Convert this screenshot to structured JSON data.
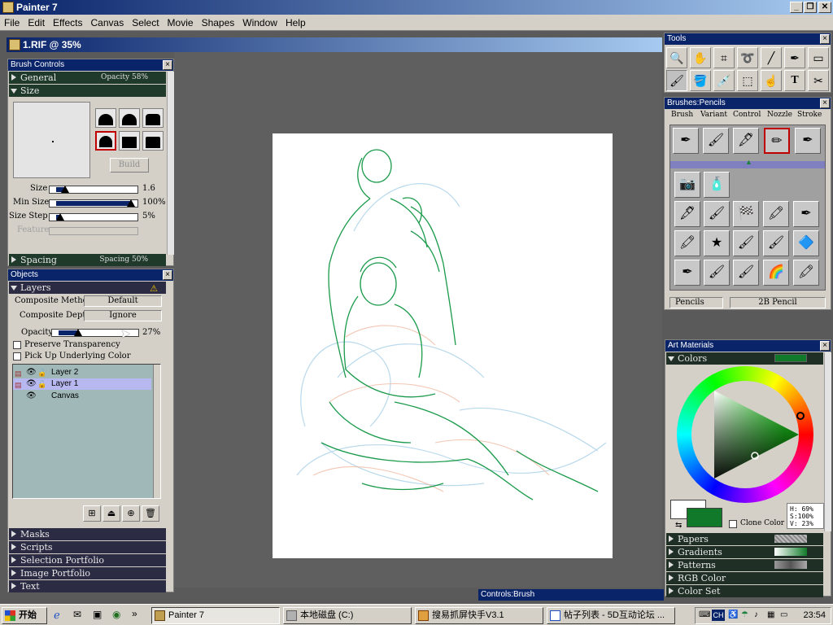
{
  "app": {
    "title": "Painter 7",
    "window_buttons": [
      "_",
      "❐",
      "✕"
    ]
  },
  "menu": [
    "File",
    "Edit",
    "Effects",
    "Canvas",
    "Select",
    "Movie",
    "Shapes",
    "Window",
    "Help"
  ],
  "document": {
    "title": "1.RIF @ 35%"
  },
  "brush_controls": {
    "title": "Brush Controls",
    "general": {
      "label": "General",
      "right": "Opacity 58%"
    },
    "size_section": "Size",
    "build_label": "Build",
    "size": {
      "label": "Size",
      "value": "1.6",
      "level": 0.12
    },
    "min_size": {
      "label": "Min Size",
      "value": "100%",
      "level": 1.0
    },
    "size_step": {
      "label": "Size Step",
      "value": "5%",
      "level": 0.05
    },
    "feature": {
      "label": "Feature"
    },
    "spacing": {
      "label": "Spacing",
      "right": "Spacing 50%"
    }
  },
  "objects": {
    "title": "Objects",
    "layers_section": "Layers",
    "composite_method": {
      "label": "Composite Method",
      "value": "Default"
    },
    "composite_depth": {
      "label": "Composite Depth",
      "value": "Ignore"
    },
    "opacity": {
      "label": "Opacity",
      "value": "27%",
      "level": 0.27
    },
    "preserve_transparency": "Preserve Transparency",
    "pick_up_underlying": "Pick Up Underlying Color",
    "layers": [
      {
        "name": "Layer 2",
        "selected": false
      },
      {
        "name": "Layer 1",
        "selected": true
      },
      {
        "name": "Canvas",
        "selected": false
      }
    ],
    "collapsed_sections": [
      "Masks",
      "Scripts",
      "Selection Portfolio",
      "Image Portfolio",
      "Text"
    ]
  },
  "tools": {
    "title": "Tools",
    "row1": [
      "🔍",
      "✋",
      "⌗",
      "➰",
      "╱",
      "✒",
      "▭"
    ],
    "row2": [
      "🖌",
      "🪣",
      "💉",
      "⬚",
      "☝",
      "T",
      "✂"
    ]
  },
  "brushes": {
    "title": "Brushes:Pencils",
    "menu": [
      "Brush",
      "Variant",
      "Control",
      "Nozzle",
      "Stroke"
    ],
    "category": "Pencils",
    "variant": "2B Pencil"
  },
  "art_materials": {
    "title": "Art Materials",
    "colors_section": "Colors",
    "accent_color": "#117a2a",
    "hsv": {
      "h": "H: 69%",
      "s": "S:100%",
      "v": "V: 23%"
    },
    "clone_color": "Clone Color",
    "sections": [
      "Papers",
      "Gradients",
      "Patterns",
      "RGB Color",
      "Color Set"
    ]
  },
  "controls_brush": {
    "title": "Controls:Brush"
  },
  "taskbar": {
    "start": "开始",
    "items": [
      "Painter 7",
      "本地磁盘 (C:)",
      "搜易抓屏快手V3.1",
      "帖子列表 - 5D互动论坛 ..."
    ],
    "tray_lang": "CH",
    "clock": "23:54"
  }
}
